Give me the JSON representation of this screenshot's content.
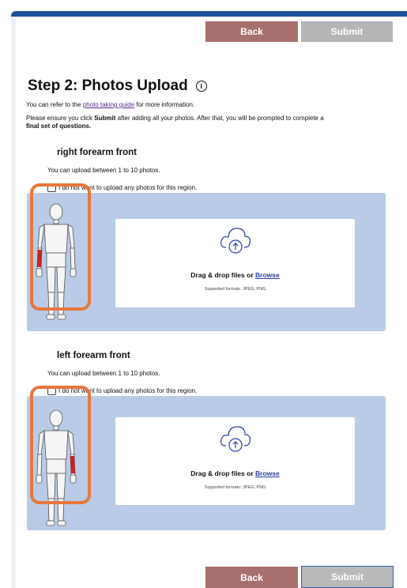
{
  "header": {
    "back_label": "Back",
    "submit_label": "Submit"
  },
  "page": {
    "title": "Step 2: Photos Upload",
    "info_icon": "info-icon",
    "guide_prefix": "You can refer to the",
    "guide_link": "photo taking guide",
    "guide_suffix": "for more information.",
    "instructions_part1": "Please ensure you click",
    "instructions_bold": "Submit",
    "instructions_part2": "after adding all your photos. After that, you will be prompted to complete a",
    "instructions_part3": "final set of questions."
  },
  "regions": [
    {
      "title": "right forearm front",
      "limit_text": "You can upload between 1 to 10 photos.",
      "optout_text": "I do not want to upload any photos for this region.",
      "drop_text": "Drag & drop files or",
      "browse_label": "Browse",
      "formats": "Supported formats: JPEG, PNG",
      "highlight_side": "right-forearm"
    },
    {
      "title": "left forearm front",
      "limit_text": "You can upload between 1 to 10 photos.",
      "optout_text": "I do not want to upload any photos for this region.",
      "drop_text": "Drag & drop files or",
      "browse_label": "Browse",
      "formats": "Supported formats: JPEG, PNG",
      "highlight_side": "left-forearm"
    }
  ],
  "footer": {
    "back_label": "Back",
    "submit_label": "Submit"
  },
  "colors": {
    "accent_bar": "#1d4f9c",
    "back_button": "#a86f6f",
    "submit_disabled": "#b5b5b5",
    "panel": "#b9cbe6",
    "highlight_ring": "#e8763c",
    "body_region": "#cc1f1f"
  }
}
